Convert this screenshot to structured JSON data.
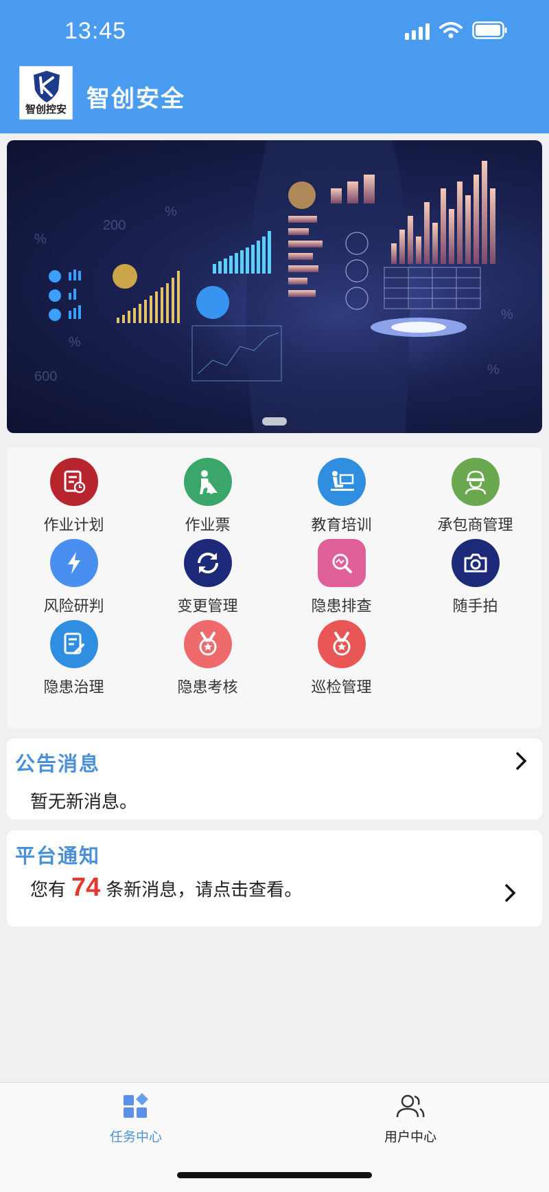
{
  "status_bar": {
    "time": "13:45"
  },
  "app": {
    "title": "智创安全",
    "logo_text": "智创控安"
  },
  "grid": [
    {
      "label": "作业计划",
      "icon": "work-plan-icon",
      "color": "#b8252f"
    },
    {
      "label": "作业票",
      "icon": "worker-icon",
      "color": "#3aa66a"
    },
    {
      "label": "教育培训",
      "icon": "training-icon",
      "color": "#2f8ee0"
    },
    {
      "label": "承包商管理",
      "icon": "contractor-icon",
      "color": "#6aa84f"
    },
    {
      "label": "风险研判",
      "icon": "lightning-icon",
      "color": "#4a8ff0"
    },
    {
      "label": "变更管理",
      "icon": "change-icon",
      "color": "#1d2a7a"
    },
    {
      "label": "隐患排查",
      "icon": "inspect-icon",
      "color": "#e0609a"
    },
    {
      "label": "随手拍",
      "icon": "camera-icon",
      "color": "#1d2a7a"
    },
    {
      "label": "隐患治理",
      "icon": "document-edit-icon",
      "color": "#2f8ee0"
    },
    {
      "label": "隐患考核",
      "icon": "medal-icon",
      "color": "#ef6a6a"
    },
    {
      "label": "巡检管理",
      "icon": "medal-icon",
      "color": "#e85656"
    }
  ],
  "announcement": {
    "title": "公告消息",
    "text": "暂无新消息。"
  },
  "platform_notice": {
    "title": "平台通知",
    "prefix": "您有",
    "count": "74",
    "suffix": "条新消息，请点击查看。"
  },
  "tabbar": {
    "tasks_label": "任务中心",
    "user_label": "用户中心",
    "active_color": "#4a90d9"
  },
  "banner": {
    "page_indicator": "1"
  }
}
